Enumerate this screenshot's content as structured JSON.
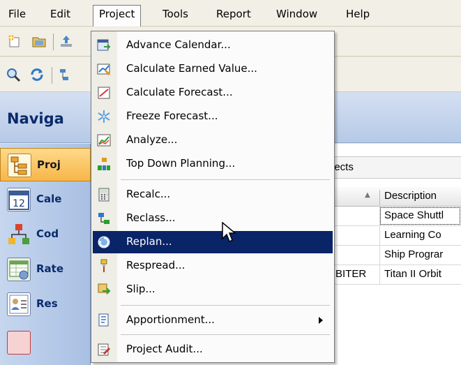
{
  "menubar": {
    "items": [
      {
        "label": "File"
      },
      {
        "label": "Edit"
      },
      {
        "label": "Project"
      },
      {
        "label": "Tools"
      },
      {
        "label": "Report"
      },
      {
        "label": "Window"
      },
      {
        "label": "Help"
      }
    ],
    "open_menu": "Project"
  },
  "navigator": {
    "title": "Naviga",
    "items": [
      {
        "label": "Proj",
        "icon": "project-tree-icon",
        "active": true
      },
      {
        "label": "Cale",
        "icon": "calendar-icon",
        "calendar_day": "12"
      },
      {
        "label": "Cod",
        "icon": "code-hierarchy-icon"
      },
      {
        "label": "Rate",
        "icon": "rate-table-icon"
      },
      {
        "label": "Res",
        "icon": "resource-icon"
      }
    ]
  },
  "content": {
    "filter_text": "jects",
    "grid": {
      "column_description": "Description",
      "rows": [
        {
          "code": "",
          "description": "Space Shuttl",
          "focused": true
        },
        {
          "code": "",
          "description": "Learning Co"
        },
        {
          "code": "",
          "description": "Ship Prograr"
        },
        {
          "code": "BITER",
          "description": "Titan II Orbit"
        }
      ]
    }
  },
  "project_menu": {
    "items": [
      {
        "label": "Advance Calendar...",
        "icon": "advance-calendar-icon"
      },
      {
        "label": "Calculate Earned Value...",
        "icon": "earned-value-icon"
      },
      {
        "label": "Calculate Forecast...",
        "icon": "forecast-icon"
      },
      {
        "label": "Freeze Forecast...",
        "icon": "snowflake-icon"
      },
      {
        "label": "Analyze...",
        "icon": "analyze-chart-icon"
      },
      {
        "label": "Top Down Planning...",
        "icon": "top-down-planning-icon"
      },
      {
        "label": "Recalc...",
        "icon": "calculator-icon"
      },
      {
        "label": "Reclass...",
        "icon": "reclass-icon"
      },
      {
        "label": "Replan...",
        "icon": "replan-icon",
        "highlighted": true
      },
      {
        "label": "Respread...",
        "icon": "paintbrush-icon"
      },
      {
        "label": "Slip...",
        "icon": "slip-icon"
      },
      {
        "label": "Apportionment...",
        "icon": "apportionment-icon",
        "submenu": true
      },
      {
        "label": "Project Audit...",
        "icon": "audit-icon"
      }
    ]
  },
  "colors": {
    "menu_highlight": "#0a2468",
    "nav_active": "#f7b648",
    "nav_header": "#b6c9e6",
    "nav_title": "#0a2a6b"
  }
}
